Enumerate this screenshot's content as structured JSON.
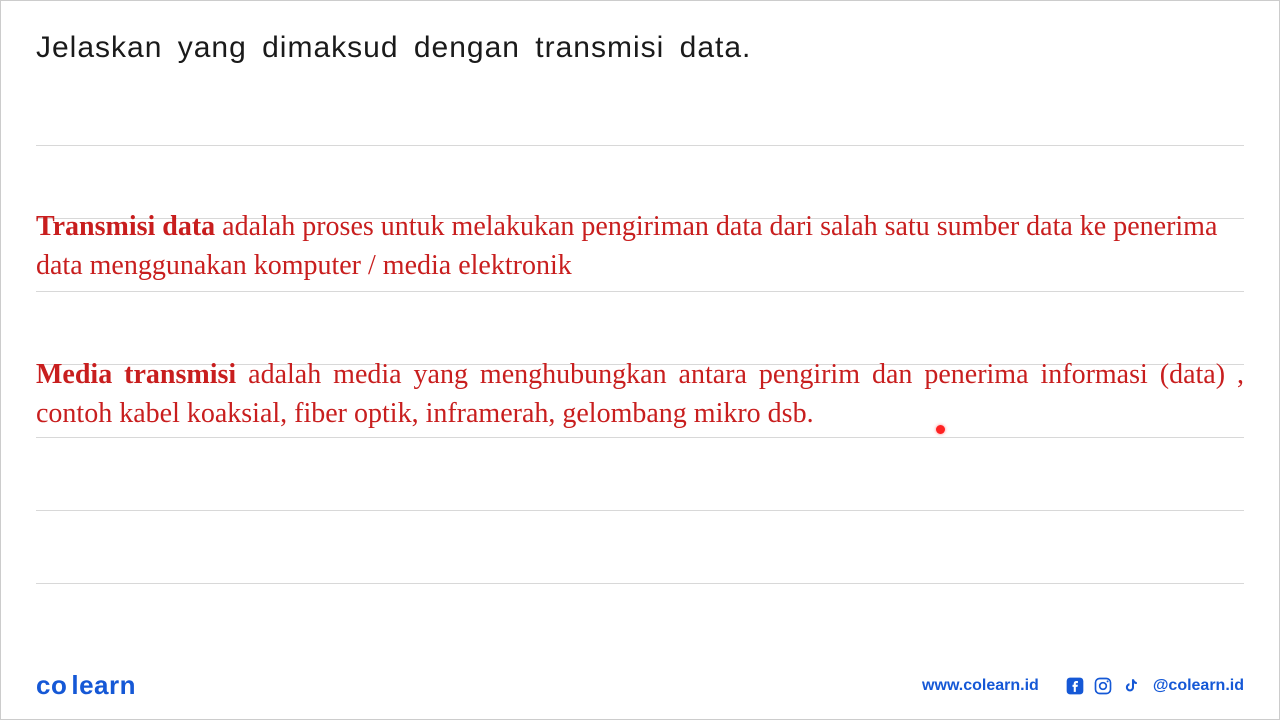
{
  "question": "Jelaskan yang dimaksud dengan transmisi data.",
  "answers": {
    "transmisi": {
      "term": "Transmisi data",
      "definition": " adalah proses untuk melakukan pengiriman data dari salah satu sumber data ke penerima data menggunakan komputer / media elektronik"
    },
    "media": {
      "term": "Media transmisi",
      "definition": " adalah media yang menghubungkan antara pengirim dan penerima informasi (data) , contoh kabel koaksial, fiber optik, inframerah, gelombang mikro dsb."
    }
  },
  "footer": {
    "logo_co": "co",
    "logo_learn": "learn",
    "website": "www.colearn.id",
    "handle": "@colearn.id"
  },
  "icons": {
    "facebook": "facebook-icon",
    "instagram": "instagram-icon",
    "tiktok": "tiktok-icon"
  }
}
